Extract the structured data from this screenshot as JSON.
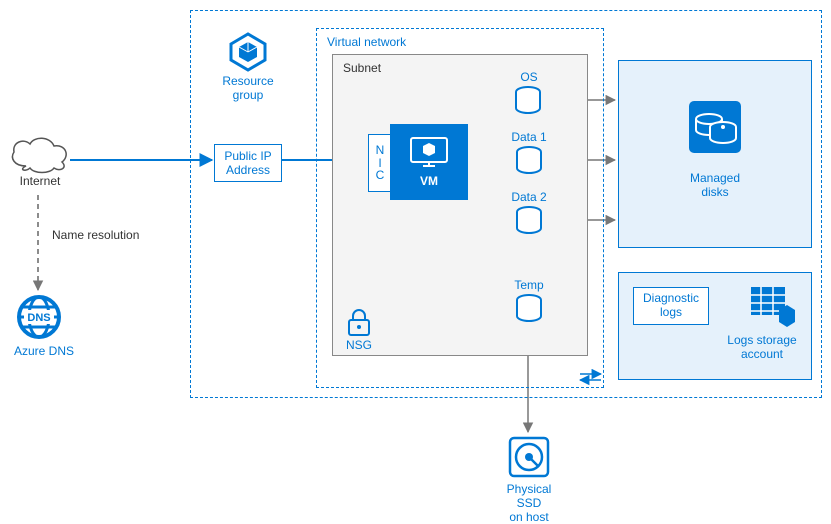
{
  "diagram": {
    "internet": {
      "label": "Internet"
    },
    "name_resolution": {
      "label": "Name resolution"
    },
    "azure_dns": {
      "label": "Azure DNS",
      "icon_text": "DNS"
    },
    "resource_group": {
      "label": "Resource\ngroup"
    },
    "public_ip": {
      "label": "Public IP\nAddress"
    },
    "virtual_network": {
      "label": "Virtual network"
    },
    "subnet": {
      "label": "Subnet"
    },
    "nic": {
      "label": "N\nI\nC"
    },
    "vm": {
      "label": "VM"
    },
    "disks": {
      "os": "OS",
      "data1": "Data 1",
      "data2": "Data 2",
      "temp": "Temp"
    },
    "nsg": {
      "label": "NSG"
    },
    "managed_disks": {
      "label": "Managed\ndisks"
    },
    "diagnostic_logs": {
      "label": "Diagnostic\nlogs"
    },
    "logs_storage": {
      "label": "Logs storage\naccount"
    },
    "physical_ssd": {
      "label": "Physical SSD\non host"
    }
  },
  "colors": {
    "primary": "#0078d4",
    "panel_bg": "#e5f1fb",
    "subnet_bg": "#f4f4f4"
  }
}
